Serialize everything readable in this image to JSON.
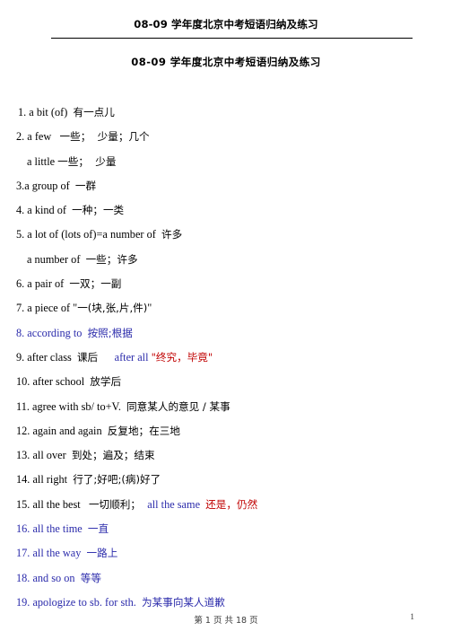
{
  "document": {
    "running_header": "08-09 学年度北京中考短语归纳及练习",
    "title": "08-09 学年度北京中考短语归纳及练习"
  },
  "entries": [
    {
      "indent": 1,
      "segments": [
        {
          "text": "1. a bit (of)  ",
          "color": "black",
          "script": "latin"
        },
        {
          "text": "有一点儿",
          "color": "black",
          "script": "cjk"
        }
      ]
    },
    {
      "indent": 0,
      "segments": [
        {
          "text": "2. a few   ",
          "color": "black",
          "script": "latin"
        },
        {
          "text": "一些；  少量；几个",
          "color": "black",
          "script": "cjk"
        }
      ]
    },
    {
      "indent": 2,
      "segments": [
        {
          "text": "a little ",
          "color": "black",
          "script": "latin"
        },
        {
          "text": "一些；  少量",
          "color": "black",
          "script": "cjk"
        }
      ]
    },
    {
      "indent": 0,
      "segments": [
        {
          "text": "3.a group of  ",
          "color": "black",
          "script": "latin"
        },
        {
          "text": "一群",
          "color": "black",
          "script": "cjk"
        }
      ]
    },
    {
      "indent": 0,
      "segments": [
        {
          "text": "4. a kind of  ",
          "color": "black",
          "script": "latin"
        },
        {
          "text": "一种；一类",
          "color": "black",
          "script": "cjk"
        }
      ]
    },
    {
      "indent": 0,
      "segments": [
        {
          "text": "5. a lot of (lots of)=a number of  ",
          "color": "black",
          "script": "latin"
        },
        {
          "text": "许多",
          "color": "black",
          "script": "cjk"
        }
      ]
    },
    {
      "indent": 2,
      "segments": [
        {
          "text": "a number of  ",
          "color": "black",
          "script": "latin"
        },
        {
          "text": "一些；许多",
          "color": "black",
          "script": "cjk"
        }
      ]
    },
    {
      "indent": 0,
      "segments": [
        {
          "text": "6. a pair of  ",
          "color": "black",
          "script": "latin"
        },
        {
          "text": "一双；一副",
          "color": "black",
          "script": "cjk"
        }
      ]
    },
    {
      "indent": 0,
      "segments": [
        {
          "text": "7. a piece of \"",
          "color": "black",
          "script": "latin"
        },
        {
          "text": "一(块,张,片,件)",
          "color": "black",
          "script": "cjk"
        },
        {
          "text": "\"",
          "color": "black",
          "script": "latin"
        }
      ]
    },
    {
      "indent": 0,
      "segments": [
        {
          "text": "8. according to  ",
          "color": "blue",
          "script": "latin"
        },
        {
          "text": "按照;根据",
          "color": "blue",
          "script": "cjk"
        }
      ]
    },
    {
      "indent": 0,
      "segments": [
        {
          "text": "9. after class  ",
          "color": "black",
          "script": "latin"
        },
        {
          "text": "课后",
          "color": "black",
          "script": "cjk"
        },
        {
          "text": "      ",
          "color": "black",
          "script": "latin"
        },
        {
          "text": "after all ",
          "color": "blue",
          "script": "latin"
        },
        {
          "text": "\"终究，毕竟\"",
          "color": "red",
          "script": "cjk"
        }
      ]
    },
    {
      "indent": 0,
      "segments": [
        {
          "text": "10. after school  ",
          "color": "black",
          "script": "latin"
        },
        {
          "text": "放学后",
          "color": "black",
          "script": "cjk"
        }
      ]
    },
    {
      "indent": 0,
      "segments": [
        {
          "text": "11. agree with sb/ to+V.  ",
          "color": "black",
          "script": "latin"
        },
        {
          "text": "同意某人的意见 / 某事",
          "color": "black",
          "script": "cjk"
        }
      ]
    },
    {
      "indent": 0,
      "segments": [
        {
          "text": "12. again and again  ",
          "color": "black",
          "script": "latin"
        },
        {
          "text": "反复地；在三地",
          "color": "black",
          "script": "cjk"
        }
      ]
    },
    {
      "indent": 0,
      "segments": [
        {
          "text": "13. all over  ",
          "color": "black",
          "script": "latin"
        },
        {
          "text": "到处；遍及；结束",
          "color": "black",
          "script": "cjk"
        }
      ]
    },
    {
      "indent": 0,
      "segments": [
        {
          "text": "14. all right  ",
          "color": "black",
          "script": "latin"
        },
        {
          "text": "行了;好吧;(病)好了",
          "color": "black",
          "script": "cjk"
        }
      ]
    },
    {
      "indent": 0,
      "segments": [
        {
          "text": "15. all the best   ",
          "color": "black",
          "script": "latin"
        },
        {
          "text": "一切顺利；  ",
          "color": "black",
          "script": "cjk"
        },
        {
          "text": "all the same  ",
          "color": "blue",
          "script": "latin"
        },
        {
          "text": "还是，仍然",
          "color": "red",
          "script": "cjk"
        }
      ]
    },
    {
      "indent": 0,
      "segments": [
        {
          "text": "16. all the time  ",
          "color": "blue",
          "script": "latin"
        },
        {
          "text": "一直",
          "color": "blue",
          "script": "cjk"
        }
      ]
    },
    {
      "indent": 0,
      "segments": [
        {
          "text": "17. all the way  ",
          "color": "blue",
          "script": "latin"
        },
        {
          "text": "一路上",
          "color": "blue",
          "script": "cjk"
        }
      ]
    },
    {
      "indent": 0,
      "segments": [
        {
          "text": "18. and so on  ",
          "color": "blue",
          "script": "latin"
        },
        {
          "text": "等等",
          "color": "blue",
          "script": "cjk"
        }
      ]
    },
    {
      "indent": 0,
      "segments": [
        {
          "text": "19. apologize to sb. for sth.  ",
          "color": "blue",
          "script": "latin"
        },
        {
          "text": "为某事向某人道歉",
          "color": "blue",
          "script": "cjk"
        }
      ]
    }
  ],
  "footer": {
    "page_indicator": "第 1 页 共 18 页",
    "page_number": "1"
  },
  "colors": {
    "black": "#000000",
    "blue": "#2b2bab",
    "red": "#c00000"
  }
}
